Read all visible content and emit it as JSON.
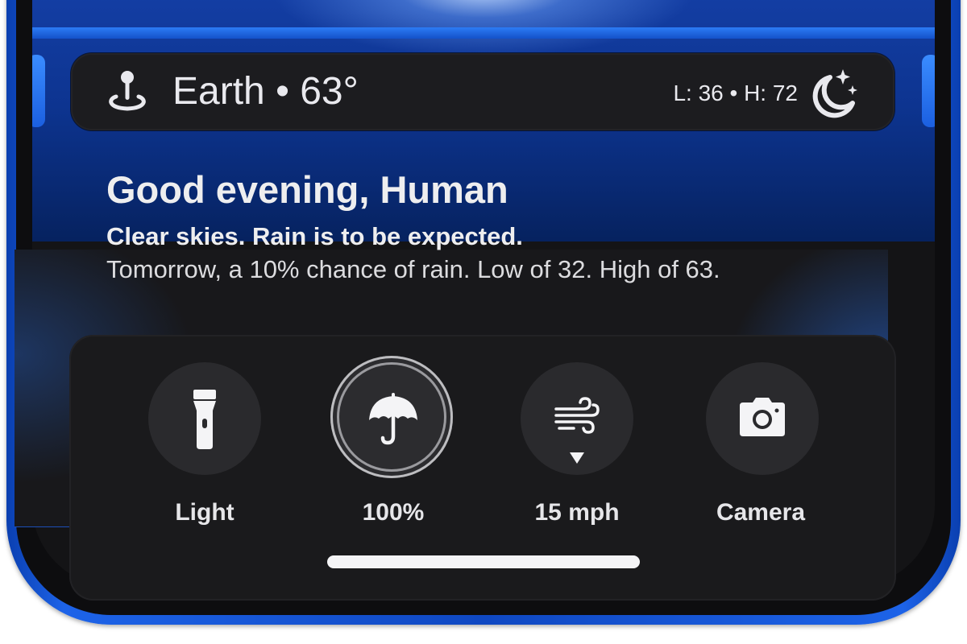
{
  "weather": {
    "location_line": "Earth • 63°",
    "hi_lo": "L: 36 • H: 72",
    "location_icon": "map-pin-icon",
    "condition_icon": "moon-stars-icon"
  },
  "greeting": {
    "title": "Good evening, Human",
    "summary": "Clear skies. Rain is to be expected.",
    "detail": "Tomorrow, a 10% chance of rain. Low of 32. High of 63."
  },
  "actions": [
    {
      "label": "Light",
      "icon": "flashlight-icon"
    },
    {
      "label": "100%",
      "icon": "umbrella-icon"
    },
    {
      "label": "15 mph",
      "icon": "wind-icon"
    },
    {
      "label": "Camera",
      "icon": "camera-icon"
    }
  ],
  "colors": {
    "frame_blue": "#1d63e8",
    "card_bg": "#1a1a1c",
    "text": "#eeeeef"
  }
}
